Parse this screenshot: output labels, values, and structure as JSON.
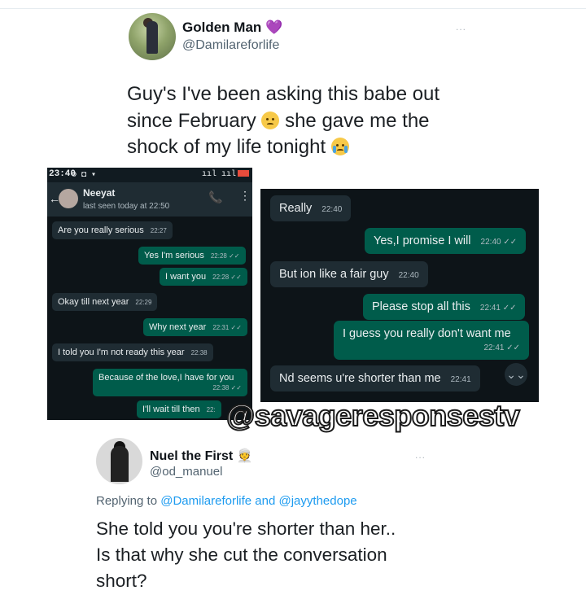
{
  "tweet1": {
    "name": "Golden Man",
    "name_emoji": "💜",
    "handle": "@Damilareforlife",
    "more": "...",
    "text_line1": "Guy's I've been asking this babe out",
    "text_line2a": "since February",
    "text_line2b": "she gave me the",
    "text_line3": "shock of my life tonight"
  },
  "chat1": {
    "status_time": "23:40",
    "status_icons": "⚙ ◘ ▾",
    "signal": "ııl ııl",
    "contact_name": "Neeyat",
    "last_seen": "last seen today at 22:50",
    "back": "←",
    "call": "📞",
    "menu": "⋮",
    "messages": [
      {
        "dir": "in",
        "text": "Are you really serious",
        "time": "22:27"
      },
      {
        "dir": "out",
        "text": "Yes I'm serious",
        "time": "22:28 ✓✓"
      },
      {
        "dir": "out",
        "text": "I want you",
        "time": "22:28 ✓✓"
      },
      {
        "dir": "in",
        "text": "Okay till next year",
        "time": "22:29"
      },
      {
        "dir": "out",
        "text": "Why next year",
        "time": "22:31 ✓✓"
      },
      {
        "dir": "in",
        "text": "I told you I'm not ready this year",
        "time": "22:38"
      },
      {
        "dir": "out",
        "text": "Because of the love,I have for you",
        "time": "22:38 ✓✓"
      },
      {
        "dir": "out",
        "text": "I'll wait till then",
        "time": "22:"
      }
    ]
  },
  "chat2": {
    "messages": [
      {
        "dir": "in",
        "text": "Really",
        "time": "22:40"
      },
      {
        "dir": "out",
        "text": "Yes,I promise I will",
        "time": "22:40 ✓✓"
      },
      {
        "dir": "in",
        "text": "But ion like a fair guy",
        "time": "22:40"
      },
      {
        "dir": "out",
        "text": "Please stop all this",
        "time": "22:41 ✓✓"
      },
      {
        "dir": "out",
        "text": "I guess you really don't want me",
        "time": "22:41 ✓✓"
      },
      {
        "dir": "in",
        "text": "Nd seems u're shorter than me",
        "time": "22:41"
      }
    ],
    "scroll_icon": "⌄⌄"
  },
  "watermark": "@savageresponsestv",
  "tweet2": {
    "name": "Nuel the First",
    "name_emoji": "👳",
    "handle": "@od_manuel",
    "more": "...",
    "replying_prefix": "Replying to",
    "replying_to": "@Damilareforlife and @jayythedope",
    "text_line1": "She told you you're shorter than her..",
    "text_line2": "Is that why she cut the conversation",
    "text_line3": "short?"
  }
}
